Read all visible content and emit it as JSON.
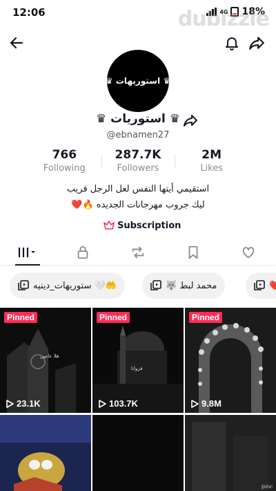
{
  "status": {
    "time": "12:06",
    "network": "4G",
    "battery": "18%"
  },
  "watermark": "dubizzle",
  "profile": {
    "avatar_text": "استوريهات",
    "crown_left": "♛",
    "crown_right": "♛",
    "display_name": "♛ استوريات ♛",
    "username": "@ebnamen27"
  },
  "stats": [
    {
      "value": "766",
      "label": "Following"
    },
    {
      "value": "287.7K",
      "label": "Followers"
    },
    {
      "value": "2M",
      "label": "Likes"
    }
  ],
  "bio": {
    "line1": "استقيمي أيتها النفس لعل الرجل قريب",
    "line2": "ليك جروب مهرجانات الجديده 🔥❤️"
  },
  "subscription": {
    "label": "Subscription"
  },
  "tabs": [
    {
      "icon": "videos-grid-icon"
    },
    {
      "icon": "lock-icon"
    },
    {
      "icon": "repost-icon"
    },
    {
      "icon": "bookmark-icon"
    },
    {
      "icon": "heart-icon"
    }
  ],
  "chips": [
    {
      "label": "🤲🤍 ستوريهات_دينيه"
    },
    {
      "label": "محمد لبط 🐺"
    },
    {
      "label": "❤️"
    }
  ],
  "videos": [
    {
      "pinned": "Pinned",
      "views": "23.1K",
      "caption": "هلا عامين"
    },
    {
      "pinned": "Pinned",
      "views": "103.7K",
      "caption": "فزوانا"
    },
    {
      "pinned": "Pinned",
      "views": "9.8M",
      "caption": ""
    },
    {
      "pinned": "",
      "views": "",
      "caption": ""
    },
    {
      "pinned": "",
      "views": "",
      "caption": ""
    },
    {
      "pinned": "",
      "views": "",
      "caption": "pov:"
    }
  ],
  "colors": {
    "accent": "#fe2c55",
    "text": "#161823",
    "muted": "#8a8b91"
  }
}
